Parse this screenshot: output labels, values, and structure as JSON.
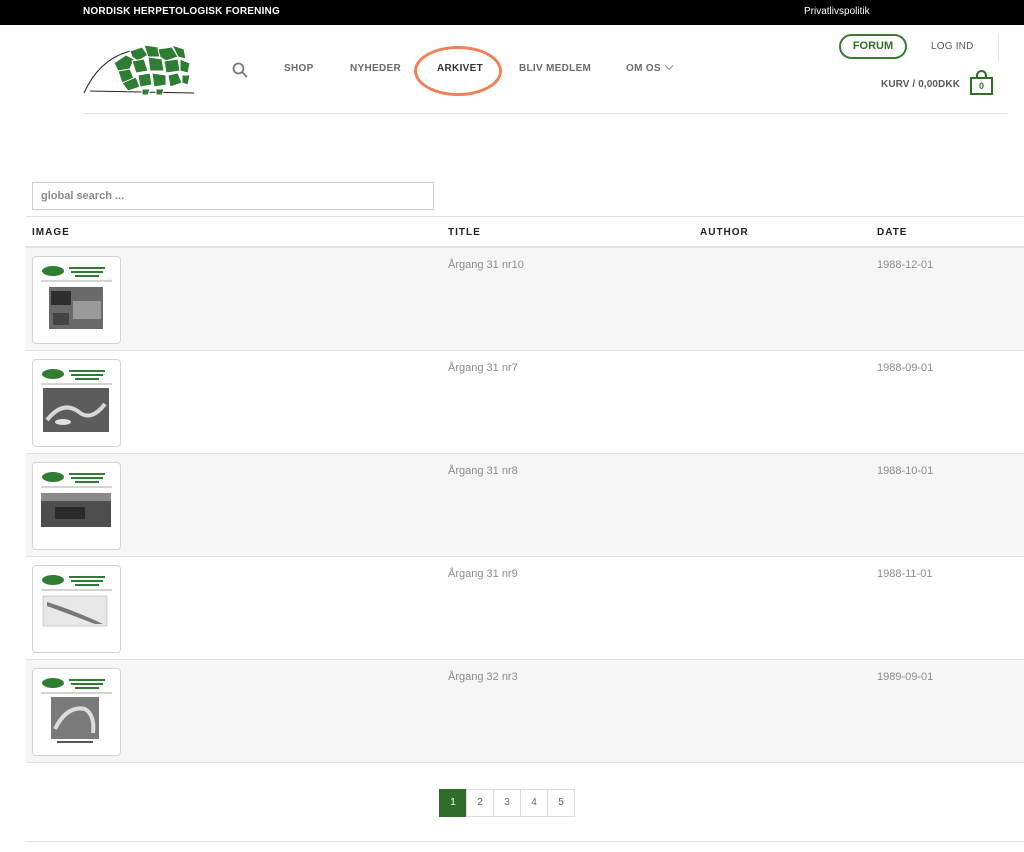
{
  "topbar": {
    "org_name": "NORDISK HERPETOLOGISK FORENING",
    "privacy": "Privatlivspolitik"
  },
  "header": {
    "search_icon": "search-icon",
    "nav": {
      "shop": "SHOP",
      "nyheder": "NYHEDER",
      "arkivet": "ARKIVET",
      "bliv_medlem": "BLIV MEDLEM",
      "om_os": "OM OS"
    },
    "forum": "FORUM",
    "login": "LOG IND",
    "cart_label": "KURV / 0,00DKK",
    "cart_count": "0"
  },
  "search": {
    "placeholder": "global search ..."
  },
  "table": {
    "headers": {
      "image": "IMAGE",
      "title": "TITLE",
      "author": "AUTHOR",
      "date": "DATE"
    },
    "rows": [
      {
        "title": "Årgang 31 nr10",
        "author": "",
        "date": "1988-12-01"
      },
      {
        "title": "Årgang 31 nr7",
        "author": "",
        "date": "1988-09-01"
      },
      {
        "title": "Årgang 31 nr8",
        "author": "",
        "date": "1988-10-01"
      },
      {
        "title": "Årgang 31 nr9",
        "author": "",
        "date": "1988-11-01"
      },
      {
        "title": "Årgang 32 nr3",
        "author": "",
        "date": "1989-09-01"
      }
    ]
  },
  "pagination": {
    "pages": [
      "1",
      "2",
      "3",
      "4",
      "5"
    ],
    "current": "1"
  },
  "colors": {
    "brand_green": "#2f6d2a",
    "highlight": "#ee8155"
  }
}
